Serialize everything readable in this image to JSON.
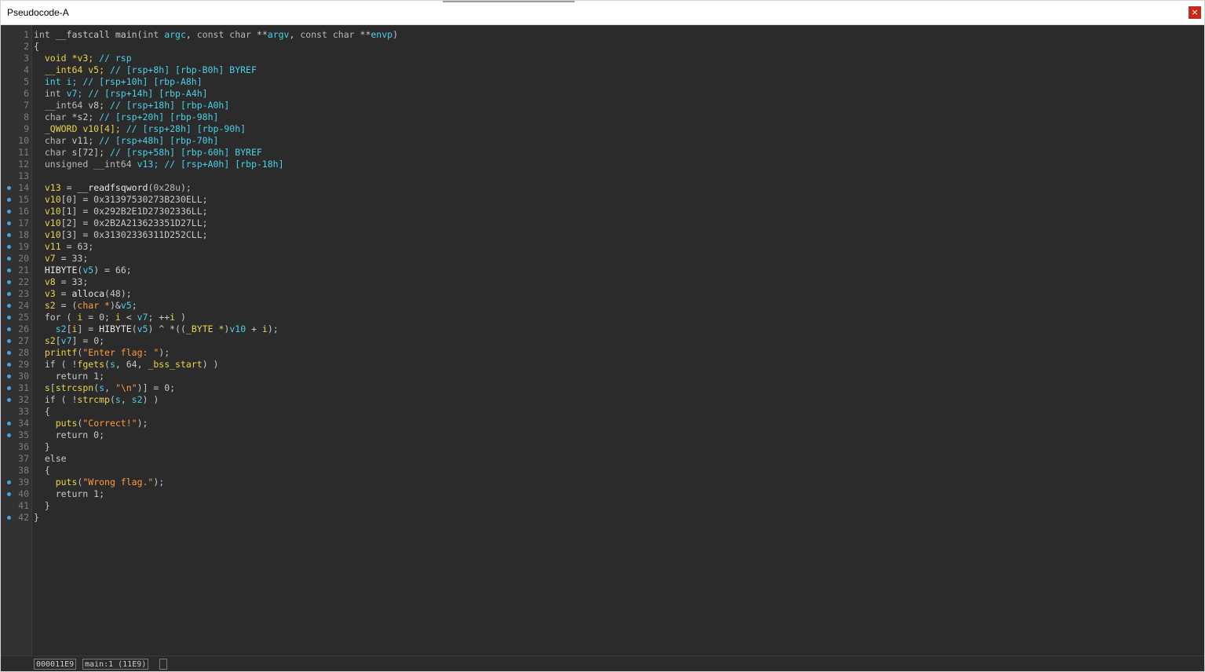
{
  "window": {
    "title": "Pseudocode-A",
    "close_label": "×"
  },
  "colors": {
    "type": "#4ad0e8",
    "comment": "#4ad0e8",
    "string": "#ff9a3c",
    "global": "#e8d44d",
    "breakpoint": "#4aa3df"
  },
  "code": {
    "lines": [
      {
        "n": "1",
        "bp": false,
        "t": [
          [
            "kw",
            "int "
          ],
          [
            "pl",
            "__fastcall main("
          ],
          [
            "kw",
            "int "
          ],
          [
            "ty",
            "argc"
          ],
          [
            "pl",
            ", "
          ],
          [
            "kw",
            "const char "
          ],
          [
            "pl",
            "**"
          ],
          [
            "ty",
            "argv"
          ],
          [
            "pl",
            ", "
          ],
          [
            "kw",
            "const char "
          ],
          [
            "pl",
            "**"
          ],
          [
            "ty",
            "envp"
          ],
          [
            "pl",
            ")"
          ]
        ]
      },
      {
        "n": "2",
        "bp": false,
        "t": [
          [
            "pl",
            "{"
          ]
        ]
      },
      {
        "n": "3",
        "bp": false,
        "t": [
          [
            "pl",
            "  "
          ],
          [
            "yl",
            "void *v3; "
          ],
          [
            "cm",
            "// rsp"
          ]
        ]
      },
      {
        "n": "4",
        "bp": false,
        "t": [
          [
            "pl",
            "  "
          ],
          [
            "yl",
            "__int64 v5; "
          ],
          [
            "cm",
            "// [rsp+8h] [rbp-B0h] BYREF"
          ]
        ]
      },
      {
        "n": "5",
        "bp": false,
        "t": [
          [
            "pl",
            "  "
          ],
          [
            "ty",
            "int i; "
          ],
          [
            "cm",
            "// [rsp+10h] [rbp-A8h]"
          ]
        ]
      },
      {
        "n": "6",
        "bp": false,
        "t": [
          [
            "pl",
            "  "
          ],
          [
            "kw",
            "int "
          ],
          [
            "ty",
            "v7; "
          ],
          [
            "cm",
            "// [rsp+14h] [rbp-A4h]"
          ]
        ]
      },
      {
        "n": "7",
        "bp": false,
        "t": [
          [
            "pl",
            "  "
          ],
          [
            "kw",
            "__int64 "
          ],
          [
            "pl",
            "v8; "
          ],
          [
            "cm",
            "// [rsp+18h] [rbp-A0h]"
          ]
        ]
      },
      {
        "n": "8",
        "bp": false,
        "t": [
          [
            "pl",
            "  "
          ],
          [
            "kw",
            "char "
          ],
          [
            "pl",
            "*s2; "
          ],
          [
            "cm",
            "// [rsp+20h] [rbp-98h]"
          ]
        ]
      },
      {
        "n": "9",
        "bp": false,
        "t": [
          [
            "pl",
            "  "
          ],
          [
            "yl",
            "_QWORD v10[4]; "
          ],
          [
            "cm",
            "// [rsp+28h] [rbp-90h]"
          ]
        ]
      },
      {
        "n": "10",
        "bp": false,
        "t": [
          [
            "pl",
            "  "
          ],
          [
            "kw",
            "char "
          ],
          [
            "pl",
            "v11; "
          ],
          [
            "cm",
            "// [rsp+48h] [rbp-70h]"
          ]
        ]
      },
      {
        "n": "11",
        "bp": false,
        "t": [
          [
            "pl",
            "  "
          ],
          [
            "kw",
            "char "
          ],
          [
            "pl",
            "s[72]; "
          ],
          [
            "cm",
            "// [rsp+58h] [rbp-60h] BYREF"
          ]
        ]
      },
      {
        "n": "12",
        "bp": false,
        "t": [
          [
            "pl",
            "  "
          ],
          [
            "kw",
            "unsigned __int64 "
          ],
          [
            "ty",
            "v13; "
          ],
          [
            "cm",
            "// [rsp+A0h] [rbp-18h]"
          ]
        ]
      },
      {
        "n": "13",
        "bp": false,
        "t": [
          [
            "pl",
            ""
          ]
        ]
      },
      {
        "n": "14",
        "bp": true,
        "t": [
          [
            "pl",
            "  "
          ],
          [
            "yl",
            "v13"
          ],
          [
            "pl",
            " = "
          ],
          [
            "fn",
            "__readfsqword"
          ],
          [
            "pl",
            "("
          ],
          [
            "nm",
            "0x28u"
          ],
          [
            "pl",
            ");"
          ]
        ]
      },
      {
        "n": "15",
        "bp": true,
        "t": [
          [
            "pl",
            "  "
          ],
          [
            "yl",
            "v10"
          ],
          [
            "pl",
            "[0] = 0x31397530273B230ELL;"
          ]
        ]
      },
      {
        "n": "16",
        "bp": true,
        "t": [
          [
            "pl",
            "  "
          ],
          [
            "yl",
            "v10"
          ],
          [
            "pl",
            "[1] = 0x292B2E1D27302336LL;"
          ]
        ]
      },
      {
        "n": "17",
        "bp": true,
        "t": [
          [
            "pl",
            "  "
          ],
          [
            "yl",
            "v10"
          ],
          [
            "pl",
            "[2] = 0x2B2A213623351D27LL;"
          ]
        ]
      },
      {
        "n": "18",
        "bp": true,
        "t": [
          [
            "pl",
            "  "
          ],
          [
            "yl",
            "v10"
          ],
          [
            "pl",
            "[3] = 0x31302336311D252CLL;"
          ]
        ]
      },
      {
        "n": "19",
        "bp": true,
        "t": [
          [
            "pl",
            "  "
          ],
          [
            "yl",
            "v11"
          ],
          [
            "pl",
            " = 63;"
          ]
        ]
      },
      {
        "n": "20",
        "bp": true,
        "t": [
          [
            "pl",
            "  "
          ],
          [
            "yl",
            "v7"
          ],
          [
            "pl",
            " = 33;"
          ]
        ]
      },
      {
        "n": "21",
        "bp": true,
        "t": [
          [
            "pl",
            "  "
          ],
          [
            "fn",
            "HIBYTE"
          ],
          [
            "pl",
            "("
          ],
          [
            "ty",
            "v5"
          ],
          [
            "pl",
            ") = 66;"
          ]
        ]
      },
      {
        "n": "22",
        "bp": true,
        "t": [
          [
            "pl",
            "  "
          ],
          [
            "yl",
            "v8"
          ],
          [
            "pl",
            " = 33;"
          ]
        ]
      },
      {
        "n": "23",
        "bp": true,
        "t": [
          [
            "pl",
            "  "
          ],
          [
            "yl",
            "v3"
          ],
          [
            "pl",
            " = "
          ],
          [
            "fn",
            "alloca"
          ],
          [
            "pl",
            "(48);"
          ]
        ]
      },
      {
        "n": "24",
        "bp": true,
        "t": [
          [
            "pl",
            "  "
          ],
          [
            "yl",
            "s2"
          ],
          [
            "pl",
            " = ("
          ],
          [
            "st",
            "char *"
          ],
          [
            "pl",
            ")&"
          ],
          [
            "ty",
            "v5"
          ],
          [
            "pl",
            ";"
          ]
        ]
      },
      {
        "n": "25",
        "bp": true,
        "t": [
          [
            "pl",
            "  for ( "
          ],
          [
            "yl",
            "i"
          ],
          [
            "pl",
            " = 0; "
          ],
          [
            "yl",
            "i"
          ],
          [
            "pl",
            " < "
          ],
          [
            "ty",
            "v7"
          ],
          [
            "pl",
            "; ++"
          ],
          [
            "yl",
            "i"
          ],
          [
            "pl",
            " )"
          ]
        ]
      },
      {
        "n": "26",
        "bp": true,
        "t": [
          [
            "pl",
            "    "
          ],
          [
            "ty",
            "s2"
          ],
          [
            "pl",
            "["
          ],
          [
            "yl",
            "i"
          ],
          [
            "pl",
            "] = "
          ],
          [
            "fn",
            "HIBYTE"
          ],
          [
            "pl",
            "("
          ],
          [
            "ty",
            "v5"
          ],
          [
            "pl",
            ") ^ *(("
          ],
          [
            "yl",
            "_BYTE *"
          ],
          [
            "pl",
            ")"
          ],
          [
            "ty",
            "v10"
          ],
          [
            "pl",
            " + "
          ],
          [
            "yl",
            "i"
          ],
          [
            "pl",
            ");"
          ]
        ]
      },
      {
        "n": "27",
        "bp": true,
        "t": [
          [
            "pl",
            "  "
          ],
          [
            "yl",
            "s2"
          ],
          [
            "pl",
            "["
          ],
          [
            "ty",
            "v7"
          ],
          [
            "pl",
            "] = 0;"
          ]
        ]
      },
      {
        "n": "28",
        "bp": true,
        "t": [
          [
            "pl",
            "  "
          ],
          [
            "yl",
            "printf"
          ],
          [
            "pl",
            "("
          ],
          [
            "st",
            "\"Enter flag: \""
          ],
          [
            "pl",
            ");"
          ]
        ]
      },
      {
        "n": "29",
        "bp": true,
        "t": [
          [
            "pl",
            "  if ( !"
          ],
          [
            "yl",
            "fgets"
          ],
          [
            "pl",
            "("
          ],
          [
            "ty",
            "s"
          ],
          [
            "pl",
            ", 64, "
          ],
          [
            "yl",
            "_bss_start"
          ],
          [
            "pl",
            ") )"
          ]
        ]
      },
      {
        "n": "30",
        "bp": true,
        "t": [
          [
            "pl",
            "    return 1;"
          ]
        ]
      },
      {
        "n": "31",
        "bp": true,
        "t": [
          [
            "pl",
            "  "
          ],
          [
            "yl",
            "s"
          ],
          [
            "pl",
            "["
          ],
          [
            "yl",
            "strcspn"
          ],
          [
            "pl",
            "("
          ],
          [
            "ty",
            "s"
          ],
          [
            "pl",
            ", "
          ],
          [
            "st",
            "\"\\n\""
          ],
          [
            "pl",
            ")] = 0;"
          ]
        ]
      },
      {
        "n": "32",
        "bp": true,
        "t": [
          [
            "pl",
            "  if ( !"
          ],
          [
            "yl",
            "strcmp"
          ],
          [
            "pl",
            "("
          ],
          [
            "ty",
            "s"
          ],
          [
            "pl",
            ", "
          ],
          [
            "ty",
            "s2"
          ],
          [
            "pl",
            ") )"
          ]
        ]
      },
      {
        "n": "33",
        "bp": false,
        "t": [
          [
            "pl",
            "  {"
          ]
        ]
      },
      {
        "n": "34",
        "bp": true,
        "t": [
          [
            "pl",
            "    "
          ],
          [
            "yl",
            "puts"
          ],
          [
            "pl",
            "("
          ],
          [
            "st",
            "\"Correct!\""
          ],
          [
            "pl",
            ");"
          ]
        ]
      },
      {
        "n": "35",
        "bp": true,
        "t": [
          [
            "pl",
            "    return 0;"
          ]
        ]
      },
      {
        "n": "36",
        "bp": false,
        "t": [
          [
            "pl",
            "  }"
          ]
        ]
      },
      {
        "n": "37",
        "bp": false,
        "t": [
          [
            "pl",
            "  else"
          ]
        ]
      },
      {
        "n": "38",
        "bp": false,
        "t": [
          [
            "pl",
            "  {"
          ]
        ]
      },
      {
        "n": "39",
        "bp": true,
        "t": [
          [
            "pl",
            "    "
          ],
          [
            "yl",
            "puts"
          ],
          [
            "pl",
            "("
          ],
          [
            "st",
            "\"Wrong flag.\""
          ],
          [
            "pl",
            ");"
          ]
        ]
      },
      {
        "n": "40",
        "bp": true,
        "t": [
          [
            "pl",
            "    return 1;"
          ]
        ]
      },
      {
        "n": "41",
        "bp": false,
        "t": [
          [
            "pl",
            "  }"
          ]
        ]
      },
      {
        "n": "42",
        "bp": true,
        "t": [
          [
            "pl",
            "}"
          ]
        ]
      }
    ]
  },
  "status": {
    "address": "000011E9",
    "location": "main:1 (11E9)",
    "extra": ""
  }
}
